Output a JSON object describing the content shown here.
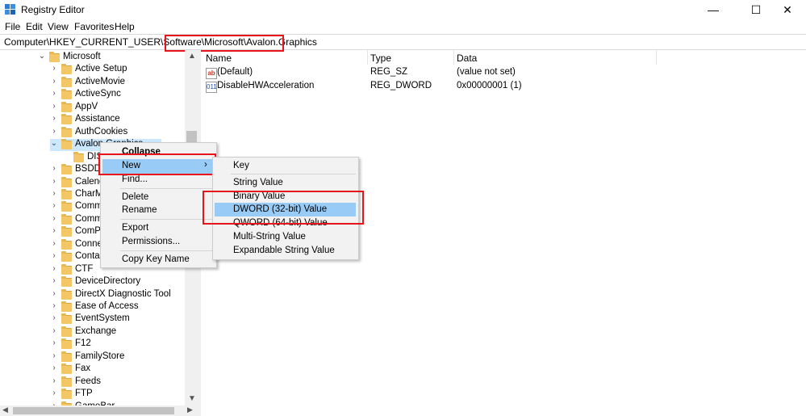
{
  "window": {
    "title": "Registry Editor",
    "controls": [
      "—",
      "☐",
      "✕"
    ]
  },
  "menubar": [
    "File",
    "Edit",
    "View",
    "Favorites",
    "Help"
  ],
  "address": {
    "path": "Computer\\HKEY_CURRENT_USER\\Software\\Microsoft\\Avalon.Graphics"
  },
  "tree": {
    "items": [
      {
        "label": "Microsoft",
        "chev": "⌄"
      },
      {
        "label": "Active Setup",
        "chev": "›"
      },
      {
        "label": "ActiveMovie",
        "chev": "›"
      },
      {
        "label": "ActiveSync",
        "chev": "›"
      },
      {
        "label": "AppV",
        "chev": "›"
      },
      {
        "label": "Assistance",
        "chev": "›"
      },
      {
        "label": "AuthCookies",
        "chev": "›"
      },
      {
        "label": "Avalon.Graphics",
        "chev": "⌄"
      },
      {
        "label": "DISPLAY1",
        "chev": ""
      },
      {
        "label": "BSDDB",
        "chev": "›"
      },
      {
        "label": "Calendar",
        "chev": "›"
      },
      {
        "label": "CharMap",
        "chev": "›"
      },
      {
        "label": "Command Processor",
        "chev": "›"
      },
      {
        "label": "CommsApps",
        "chev": "›"
      },
      {
        "label": "ComPstUI",
        "chev": "›"
      },
      {
        "label": "Connection Manager",
        "chev": "›"
      },
      {
        "label": "Contacts",
        "chev": "›"
      },
      {
        "label": "CTF",
        "chev": "›"
      },
      {
        "label": "DeviceDirectory",
        "chev": "›"
      },
      {
        "label": "DirectX Diagnostic Tool",
        "chev": "›"
      },
      {
        "label": "Ease of Access",
        "chev": "›"
      },
      {
        "label": "EventSystem",
        "chev": "›"
      },
      {
        "label": "Exchange",
        "chev": "›"
      },
      {
        "label": "F12",
        "chev": "›"
      },
      {
        "label": "FamilyStore",
        "chev": "›"
      },
      {
        "label": "Fax",
        "chev": "›"
      },
      {
        "label": "Feeds",
        "chev": "›"
      },
      {
        "label": "FTP",
        "chev": "›"
      },
      {
        "label": "GameBar",
        "chev": "›"
      }
    ]
  },
  "list": {
    "columns": [
      "Name",
      "Type",
      "Data"
    ],
    "rows": [
      {
        "icon": "ab",
        "name": "(Default)",
        "type": "REG_SZ",
        "data": "(value not set)"
      },
      {
        "icon": "011",
        "name": "DisableHWAcceleration",
        "type": "REG_DWORD",
        "data": "0x00000001 (1)"
      }
    ]
  },
  "context_menu": {
    "items": [
      "Collapse",
      "New",
      "Find...",
      "Delete",
      "Rename",
      "Export",
      "Permissions...",
      "Copy Key Name"
    ],
    "submenu_arrow": "›"
  },
  "new_submenu": {
    "items": [
      "Key",
      "String Value",
      "Binary Value",
      "DWORD (32-bit) Value",
      "QWORD (64-bit) Value",
      "Multi-String Value",
      "Expandable String Value"
    ]
  },
  "colors": {
    "highlight": "#99cbf7",
    "annotation_red": "#e8141b",
    "folder": "#f3c766"
  }
}
